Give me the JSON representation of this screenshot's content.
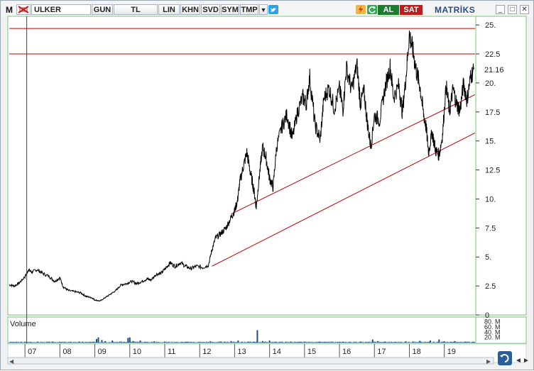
{
  "toolbar": {
    "app_letter": "M",
    "symbol": "ULKER",
    "buttons": [
      "GUN",
      "TL",
      "LIN",
      "KHN",
      "SVD",
      "SYM",
      "TMP"
    ],
    "buy_label": "AL",
    "sell_label": "SAT",
    "brand": "MATRİKS",
    "accent_buy": "#1d7b2e",
    "accent_sell": "#c01a1a"
  },
  "volume_panel": {
    "title": "Volume",
    "tick_labels": [
      "80. M",
      "60. M",
      "40. M",
      "20. M"
    ]
  },
  "chart_data": {
    "type": "line",
    "title": "",
    "series": [
      {
        "values_x_years": [
          2006.4,
          2006.6,
          2006.8,
          2007.0,
          2007.1,
          2007.3,
          2007.5,
          2007.7,
          2007.9,
          2008.1,
          2008.3,
          2008.5,
          2008.7,
          2008.9,
          2009.0,
          2009.1,
          2009.2,
          2009.4,
          2009.6,
          2009.8,
          2010.0,
          2010.2,
          2010.4,
          2010.6,
          2010.8,
          2011.0,
          2011.2,
          2011.4,
          2011.6,
          2011.8,
          2012.0,
          2012.2,
          2012.35,
          2012.5,
          2012.7,
          2012.9,
          2013.0,
          2013.1,
          2013.2,
          2013.3,
          2013.4,
          2013.5,
          2013.6,
          2013.7,
          2013.8,
          2013.9,
          2014.0,
          2014.1,
          2014.2,
          2014.4,
          2014.6,
          2014.8,
          2015.0,
          2015.2,
          2015.4,
          2015.5,
          2015.7,
          2015.9,
          2016.0,
          2016.2,
          2016.4,
          2016.6,
          2016.8,
          2017.0,
          2017.2,
          2017.4,
          2017.6,
          2017.8,
          2018.0,
          2018.1,
          2018.2,
          2018.4,
          2018.6,
          2018.8,
          2019.0,
          2019.2,
          2019.4,
          2019.6,
          2019.8
        ]
      }
    ],
    "y_ticks": [
      25,
      22.5,
      20,
      17.5,
      15,
      12.5,
      10,
      7.5,
      5,
      2.5,
      0
    ],
    "y_tick_labels": [
      "25.",
      "22.5",
      "20.",
      "17.5",
      "15.",
      "12.5",
      "10.",
      "7.5",
      "5.",
      "2.5",
      "0"
    ],
    "last_value_label": "21.16",
    "ylim": [
      0,
      25.5
    ],
    "x_tick_labels": [
      "07",
      "08",
      "09",
      "10",
      "11",
      "12",
      "13",
      "14",
      "15",
      "16",
      "17",
      "18",
      "19"
    ],
    "x_ticks_years": [
      2007,
      2008,
      2009,
      2010,
      2011,
      2012,
      2013,
      2014,
      2015,
      2016,
      2017,
      2018,
      2019
    ],
    "xlim": [
      2006.55,
      2019.88
    ],
    "price": [
      [
        2006.55,
        2.6
      ],
      [
        2006.7,
        2.5
      ],
      [
        2006.85,
        2.8
      ],
      [
        2007.0,
        3.3
      ],
      [
        2007.1,
        3.9
      ],
      [
        2007.2,
        3.7
      ],
      [
        2007.35,
        3.9
      ],
      [
        2007.5,
        3.6
      ],
      [
        2007.7,
        3.3
      ],
      [
        2007.85,
        2.9
      ],
      [
        2008.0,
        3.2
      ],
      [
        2008.1,
        2.4
      ],
      [
        2008.25,
        2.1
      ],
      [
        2008.45,
        2.0
      ],
      [
        2008.6,
        1.9
      ],
      [
        2008.75,
        1.6
      ],
      [
        2008.9,
        1.5
      ],
      [
        2009.0,
        1.3
      ],
      [
        2009.15,
        1.2
      ],
      [
        2009.3,
        1.5
      ],
      [
        2009.45,
        1.8
      ],
      [
        2009.6,
        2.1
      ],
      [
        2009.75,
        2.6
      ],
      [
        2009.9,
        2.7
      ],
      [
        2010.05,
        2.9
      ],
      [
        2010.2,
        2.7
      ],
      [
        2010.35,
        2.9
      ],
      [
        2010.5,
        3.1
      ],
      [
        2010.6,
        3.0
      ],
      [
        2010.75,
        3.5
      ],
      [
        2010.9,
        3.6
      ],
      [
        2011.05,
        4.1
      ],
      [
        2011.15,
        4.5
      ],
      [
        2011.3,
        4.2
      ],
      [
        2011.45,
        4.5
      ],
      [
        2011.6,
        4.2
      ],
      [
        2011.75,
        4.0
      ],
      [
        2011.9,
        4.2
      ],
      [
        2012.1,
        4.1
      ],
      [
        2012.25,
        4.3
      ],
      [
        2012.35,
        5.6
      ],
      [
        2012.45,
        6.6
      ],
      [
        2012.6,
        7.0
      ],
      [
        2012.75,
        7.5
      ],
      [
        2012.9,
        8.4
      ],
      [
        2013.0,
        9.0
      ],
      [
        2013.08,
        9.8
      ],
      [
        2013.15,
        11.5
      ],
      [
        2013.25,
        12.8
      ],
      [
        2013.35,
        14.0
      ],
      [
        2013.45,
        12.3
      ],
      [
        2013.55,
        10.8
      ],
      [
        2013.62,
        9.3
      ],
      [
        2013.7,
        11.8
      ],
      [
        2013.8,
        14.5
      ],
      [
        2013.9,
        13.5
      ],
      [
        2014.0,
        11.8
      ],
      [
        2014.1,
        11.0
      ],
      [
        2014.2,
        14.5
      ],
      [
        2014.35,
        16.2
      ],
      [
        2014.5,
        17.3
      ],
      [
        2014.65,
        15.2
      ],
      [
        2014.8,
        17.5
      ],
      [
        2014.95,
        18.8
      ],
      [
        2015.05,
        18.2
      ],
      [
        2015.15,
        20.5
      ],
      [
        2015.3,
        16.4
      ],
      [
        2015.45,
        15.1
      ],
      [
        2015.55,
        18.6
      ],
      [
        2015.7,
        19.6
      ],
      [
        2015.85,
        17.8
      ],
      [
        2016.0,
        19.5
      ],
      [
        2016.1,
        17.7
      ],
      [
        2016.2,
        21.3
      ],
      [
        2016.35,
        19.4
      ],
      [
        2016.5,
        21.6
      ],
      [
        2016.6,
        18.2
      ],
      [
        2016.7,
        19.3
      ],
      [
        2016.8,
        16.5
      ],
      [
        2016.9,
        14.5
      ],
      [
        2017.0,
        17.2
      ],
      [
        2017.15,
        16.8
      ],
      [
        2017.3,
        19.5
      ],
      [
        2017.45,
        21.4
      ],
      [
        2017.55,
        18.8
      ],
      [
        2017.7,
        19.8
      ],
      [
        2017.8,
        17.5
      ],
      [
        2017.9,
        20.4
      ],
      [
        2018.0,
        24.2
      ],
      [
        2018.1,
        22.8
      ],
      [
        2018.2,
        21.0
      ],
      [
        2018.3,
        19.8
      ],
      [
        2018.4,
        17.4
      ],
      [
        2018.48,
        16.2
      ],
      [
        2018.55,
        14.0
      ],
      [
        2018.65,
        15.8
      ],
      [
        2018.75,
        14.2
      ],
      [
        2018.85,
        13.8
      ],
      [
        2018.95,
        15.5
      ],
      [
        2019.05,
        19.8
      ],
      [
        2019.15,
        17.5
      ],
      [
        2019.25,
        19.5
      ],
      [
        2019.35,
        18.2
      ],
      [
        2019.45,
        17.6
      ],
      [
        2019.55,
        20.0
      ],
      [
        2019.65,
        18.5
      ],
      [
        2019.75,
        20.5
      ],
      [
        2019.85,
        21.2
      ]
    ],
    "resistance_lines": [
      24.7,
      22.5
    ],
    "trendlines": [
      {
        "from": [
          2012.9,
          8.7
        ],
        "to": [
          2019.88,
          19.0
        ]
      },
      {
        "from": [
          2012.35,
          4.2
        ],
        "to": [
          2019.88,
          15.7
        ]
      }
    ],
    "cursor_year": 2007.05,
    "volume": [
      [
        2006.6,
        1
      ],
      [
        2007.0,
        2
      ],
      [
        2007.5,
        1
      ],
      [
        2008.0,
        2
      ],
      [
        2008.5,
        1
      ],
      [
        2009.0,
        2
      ],
      [
        2009.05,
        14
      ],
      [
        2009.1,
        20
      ],
      [
        2009.2,
        10
      ],
      [
        2009.3,
        6
      ],
      [
        2009.5,
        8
      ],
      [
        2009.75,
        4
      ],
      [
        2009.95,
        18
      ],
      [
        2010.0,
        20
      ],
      [
        2010.1,
        6
      ],
      [
        2010.3,
        8
      ],
      [
        2010.5,
        3
      ],
      [
        2010.7,
        5
      ],
      [
        2011.0,
        4
      ],
      [
        2011.3,
        2
      ],
      [
        2011.6,
        3
      ],
      [
        2012.0,
        2
      ],
      [
        2012.3,
        5
      ],
      [
        2012.6,
        4
      ],
      [
        2012.9,
        6
      ],
      [
        2013.1,
        8
      ],
      [
        2013.2,
        3
      ],
      [
        2013.4,
        4
      ],
      [
        2013.65,
        48
      ],
      [
        2013.8,
        6
      ],
      [
        2014.0,
        8
      ],
      [
        2014.3,
        3
      ],
      [
        2014.6,
        4
      ],
      [
        2015.0,
        3
      ],
      [
        2015.3,
        2
      ],
      [
        2015.6,
        3
      ],
      [
        2016.0,
        2
      ],
      [
        2016.3,
        3
      ],
      [
        2016.6,
        4
      ],
      [
        2016.95,
        12
      ],
      [
        2017.1,
        6
      ],
      [
        2017.3,
        4
      ],
      [
        2017.6,
        3
      ],
      [
        2017.9,
        5
      ],
      [
        2018.1,
        4
      ],
      [
        2018.3,
        7
      ],
      [
        2018.6,
        8
      ],
      [
        2018.85,
        12
      ],
      [
        2019.0,
        5
      ],
      [
        2019.3,
        6
      ],
      [
        2019.6,
        4
      ],
      [
        2019.8,
        3
      ]
    ],
    "volume_ylim": [
      0,
      90
    ],
    "grid": false,
    "colors": {
      "price": "#000000",
      "hline": "#c00000",
      "trend": "#c00000",
      "volume": "#1e4f7a",
      "panel_border": "#7ec37e"
    }
  }
}
